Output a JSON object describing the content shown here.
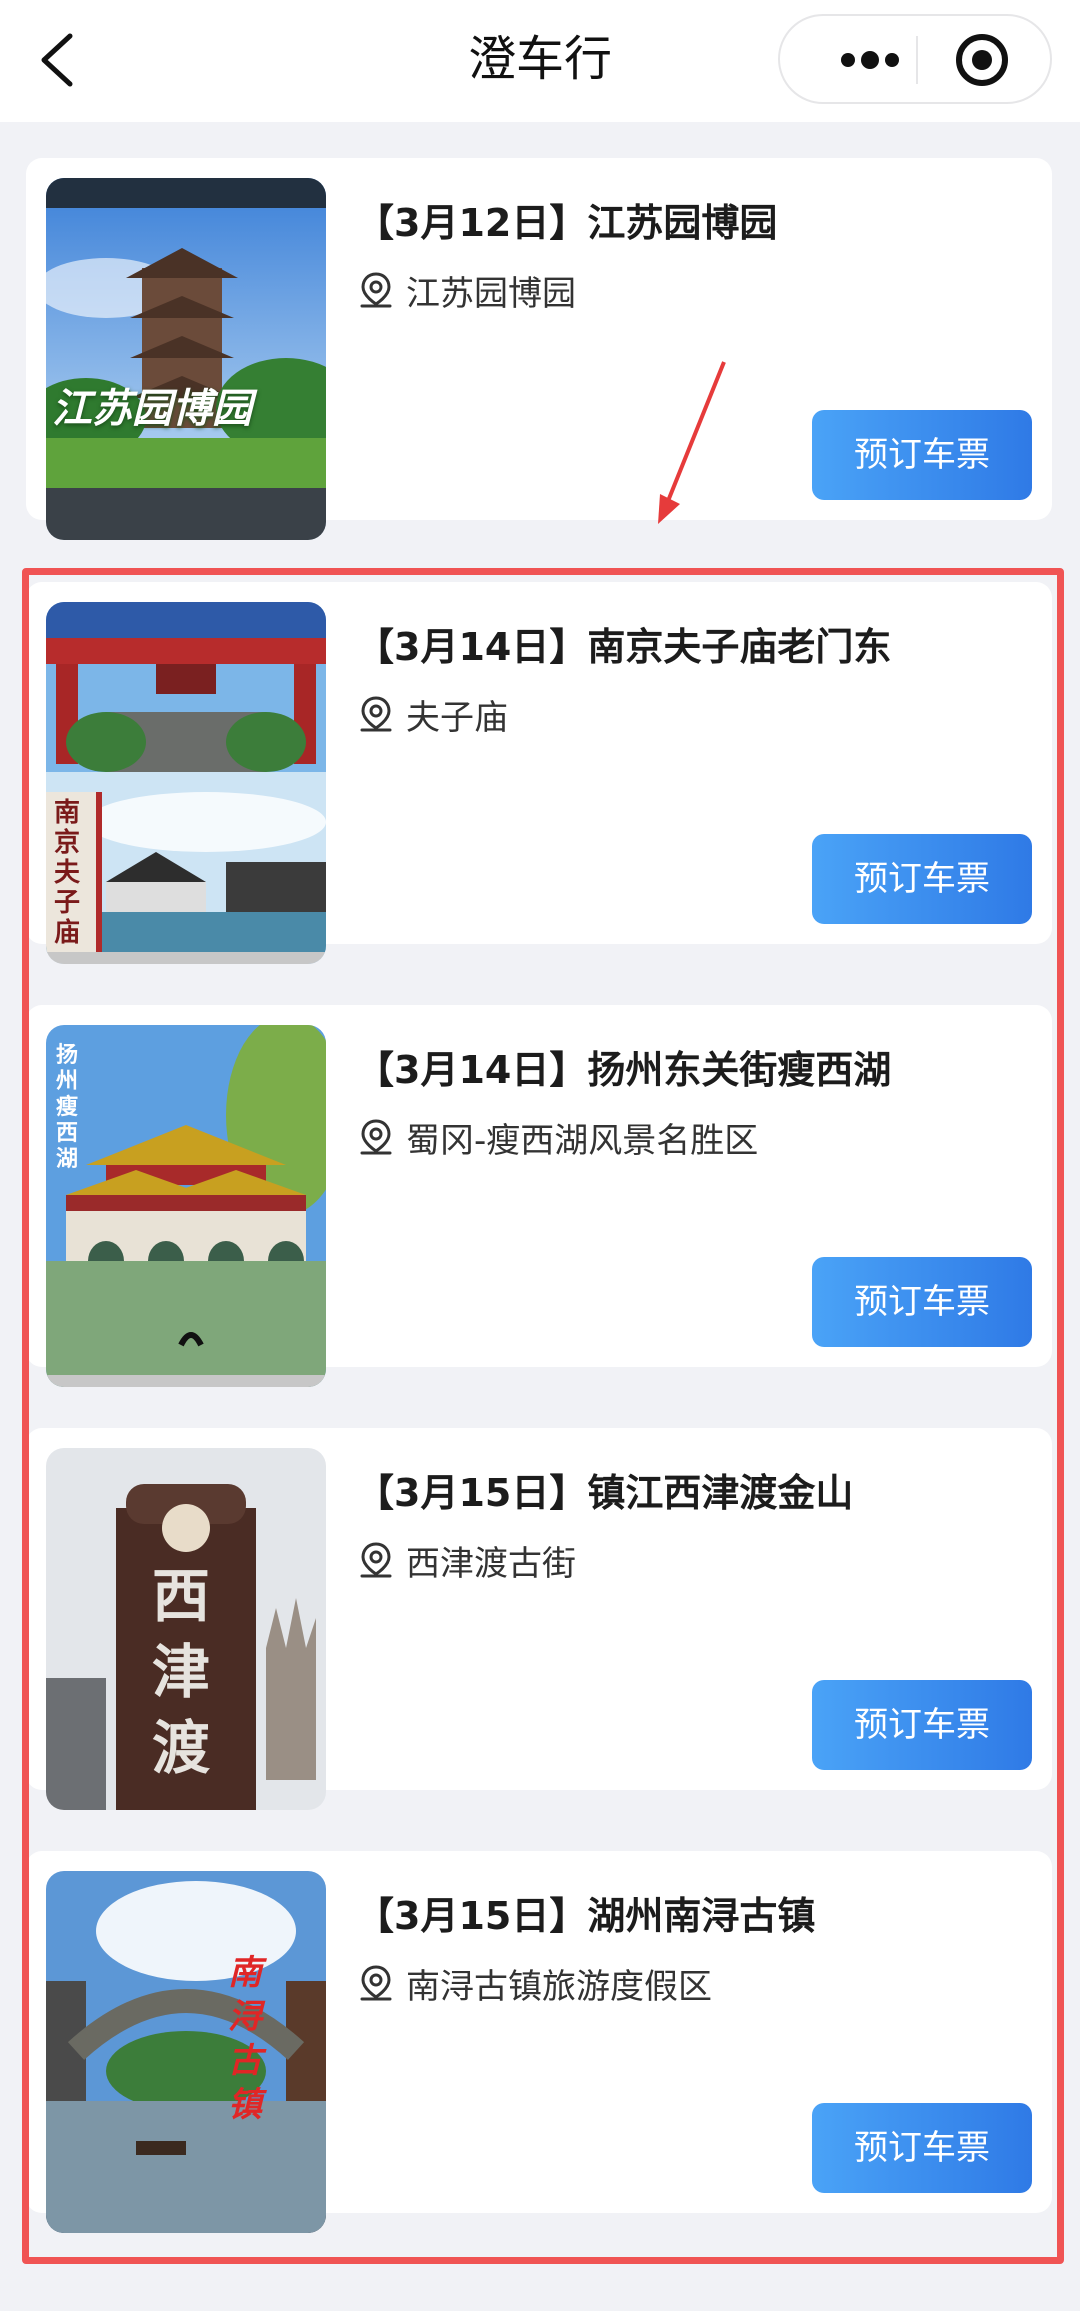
{
  "header": {
    "title": "澄车行"
  },
  "trips": [
    {
      "title": "【3月12日】江苏园博园",
      "location": "江苏园博园",
      "button": "预订车票",
      "photo_caption": "江苏园博园"
    },
    {
      "title": "【3月14日】南京夫子庙老门东",
      "location": "夫子庙",
      "button": "预订车票",
      "photo_caption": "南京夫子庙"
    },
    {
      "title": "【3月14日】扬州东关街瘦西湖",
      "location": "蜀冈-瘦西湖风景名胜区",
      "button": "预订车票",
      "photo_caption": "扬州 瘦西湖"
    },
    {
      "title": "【3月15日】镇江西津渡金山",
      "location": "西津渡古街",
      "button": "预订车票",
      "photo_caption": "西津渡"
    },
    {
      "title": "【3月15日】湖州南浔古镇",
      "location": "南浔古镇旅游度假区",
      "button": "预订车票",
      "photo_caption": "南浔古镇"
    }
  ],
  "colors": {
    "button": "#3a8ef0",
    "highlight": "#f05454",
    "arrow": "#e63b3b"
  },
  "icons": [
    "back-icon",
    "more-icon",
    "close-target-icon",
    "location-pin-icon",
    "arrow-annotation-icon"
  ]
}
